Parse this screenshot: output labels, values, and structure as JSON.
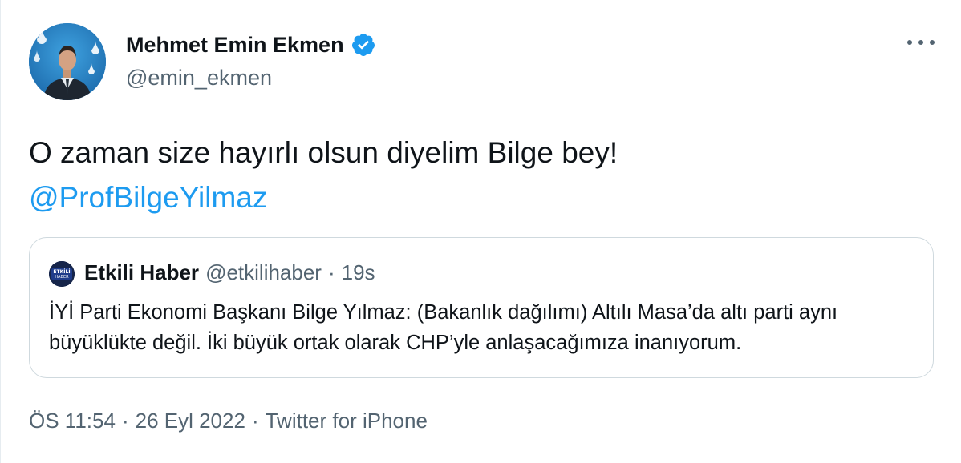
{
  "author": {
    "name": "Mehmet Emin Ekmen",
    "handle": "@emin_ekmen",
    "verified": true,
    "verified_color": "#1d9bf0"
  },
  "tweet": {
    "text": "O zaman size hayırlı olsun diyelim Bilge bey!",
    "mention": "@ProfBilgeYilmaz"
  },
  "quoted_tweet": {
    "name": "Etkili Haber",
    "handle": "@etkilihaber",
    "separator": "·",
    "time": "19s",
    "avatar_text": [
      "ETKİLİ",
      "HABER"
    ],
    "text": "İYİ Parti Ekonomi Başkanı Bilge Yılmaz: (Bakanlık dağılımı) Altılı Masa’da altı parti aynı büyüklükte değil. İki büyük ortak olarak CHP’yle anlaşacağımıza inanıyorum."
  },
  "meta": {
    "time": "ÖS 11:54",
    "sep1": "·",
    "date": "26 Eyl 2022",
    "sep2": "·",
    "source": "Twitter for iPhone"
  },
  "colors": {
    "link": "#1d9bf0",
    "secondary_text": "#536471",
    "border": "#cfd9de"
  }
}
